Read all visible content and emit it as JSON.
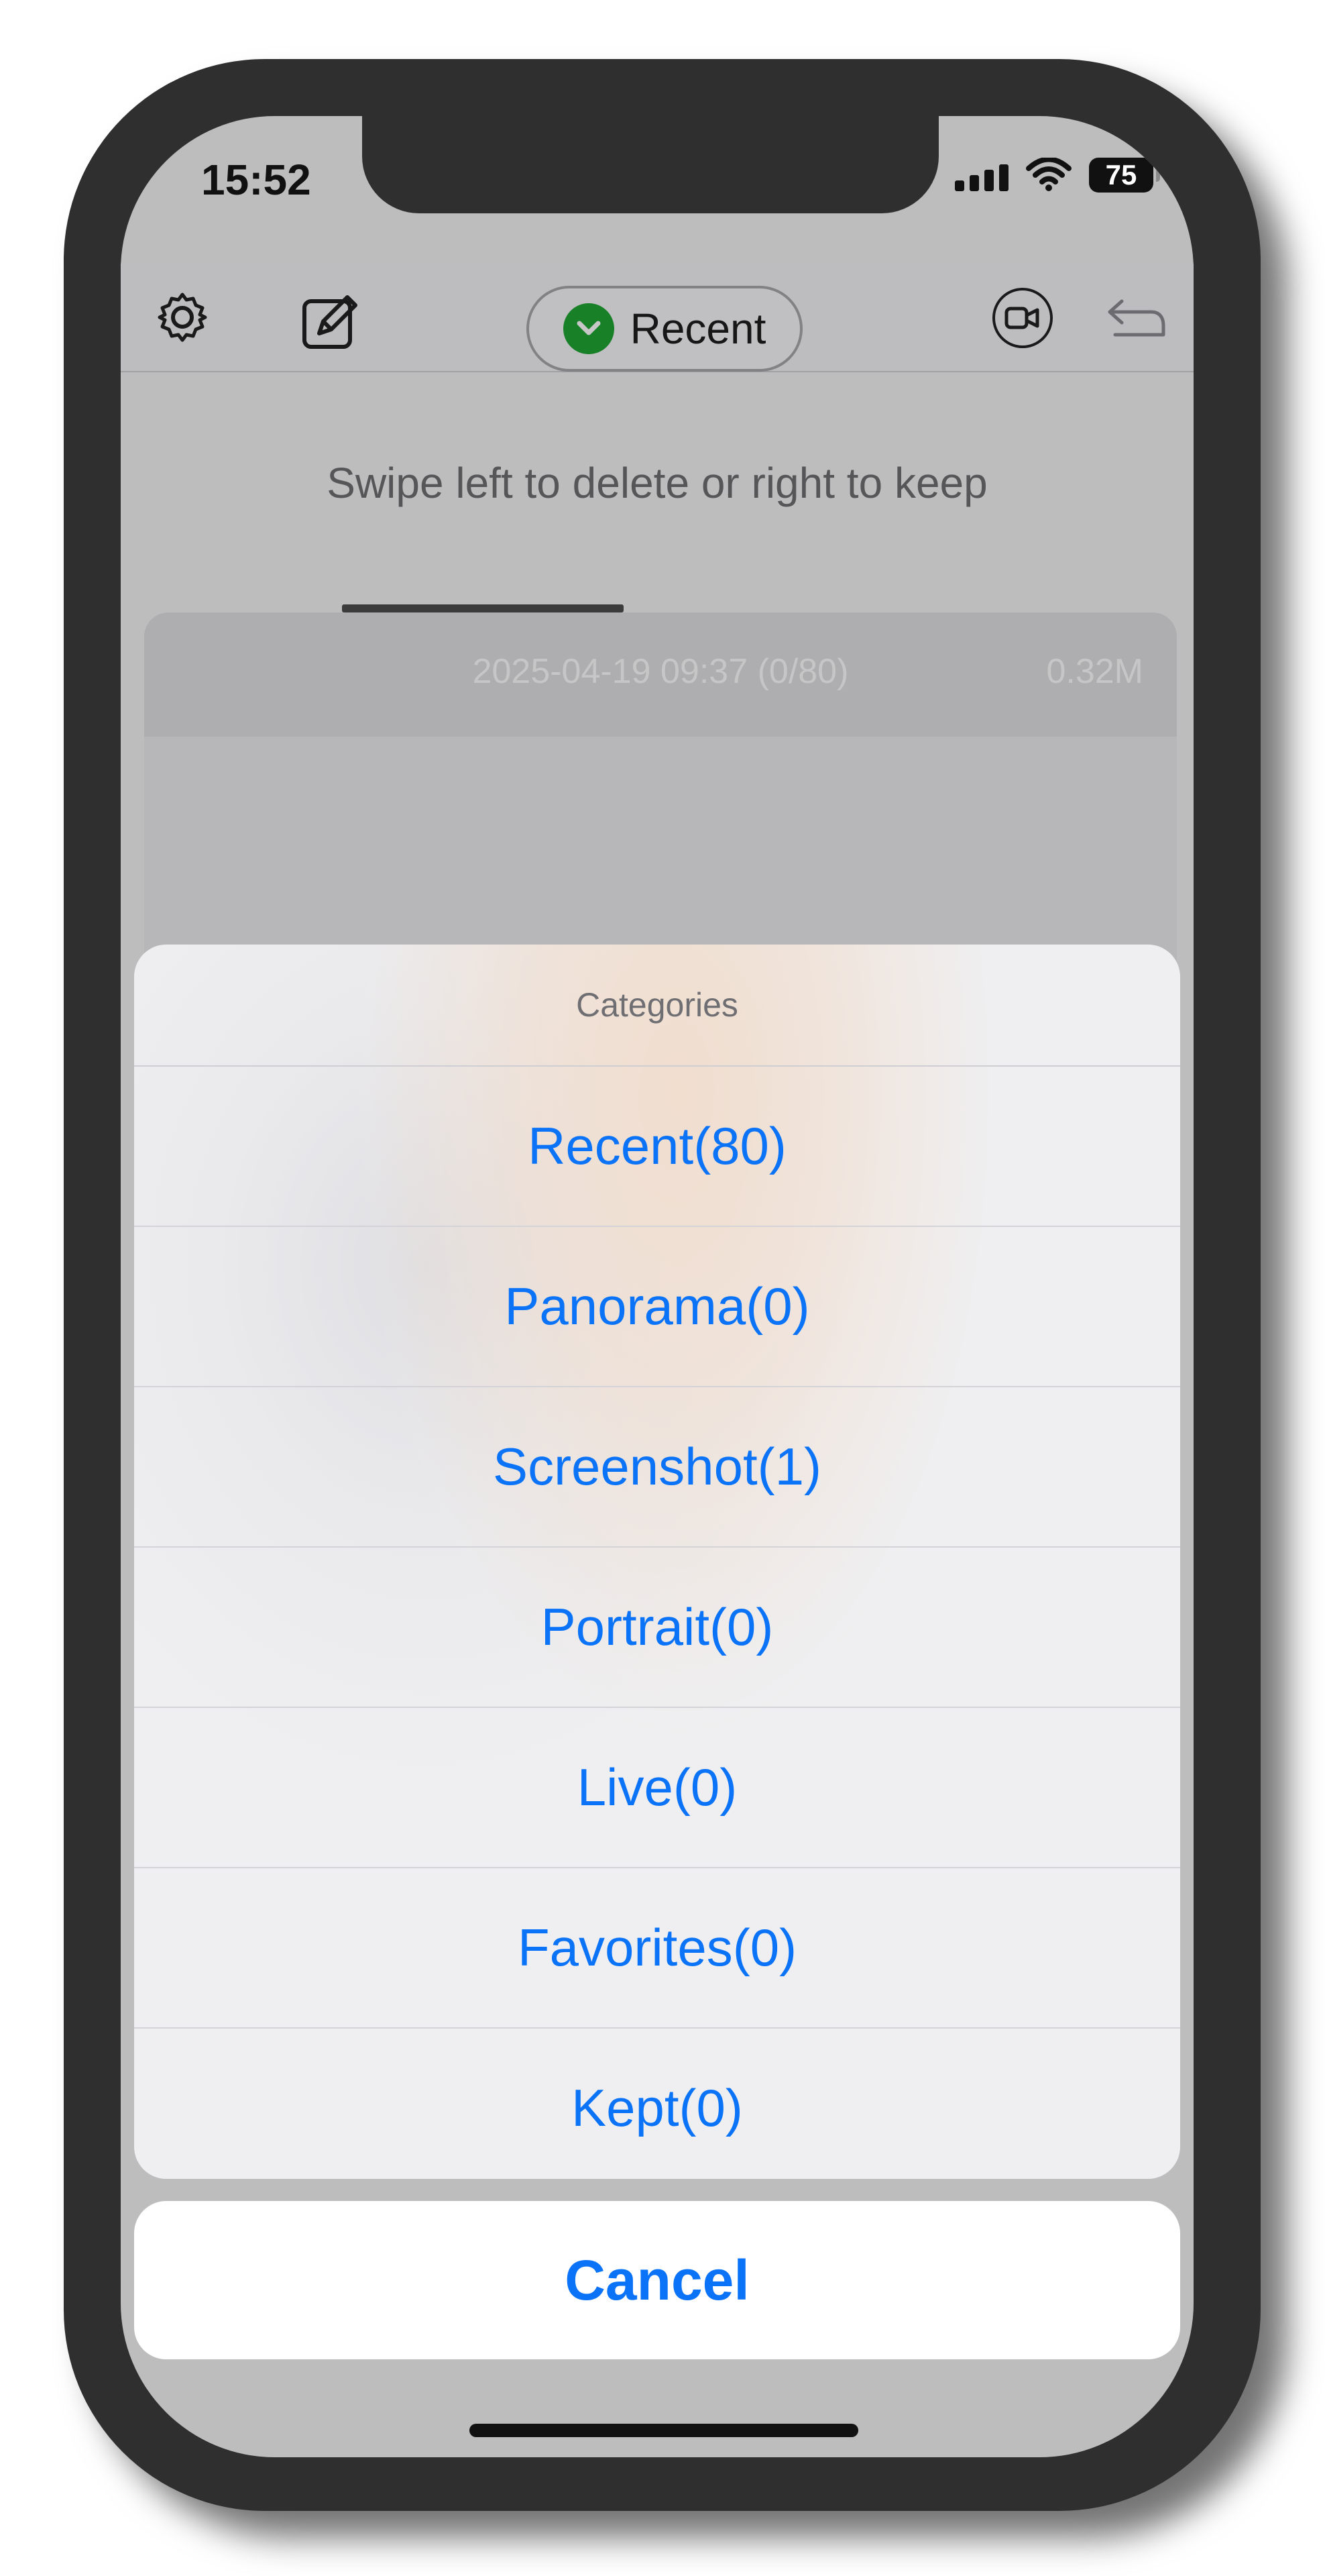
{
  "status_bar": {
    "time": "15:52",
    "battery": "75",
    "signal_icon": "cellular-icon",
    "wifi_icon": "wifi-icon",
    "battery_icon": "battery-icon"
  },
  "header": {
    "settings_icon": "gear-icon",
    "edit_icon": "edit-icon",
    "category_button_label": "Recent",
    "category_check_icon": "chevron-down-circle-icon",
    "video_icon": "video-icon",
    "undo_icon": "undo-icon",
    "accent_green": "#1fa533"
  },
  "main": {
    "instruction": "Swipe left to delete or right to keep",
    "card": {
      "date_progress": "2025-04-19 09:37 (0/80)",
      "size": "0.32M"
    }
  },
  "action_sheet": {
    "title": "Categories",
    "options": [
      "Recent(80)",
      "Panorama(0)",
      "Screenshot(1)",
      "Portrait(0)",
      "Live(0)",
      "Favorites(0)",
      "Kept(0)"
    ],
    "cancel_label": "Cancel",
    "accent_blue": "#0b73f7"
  }
}
